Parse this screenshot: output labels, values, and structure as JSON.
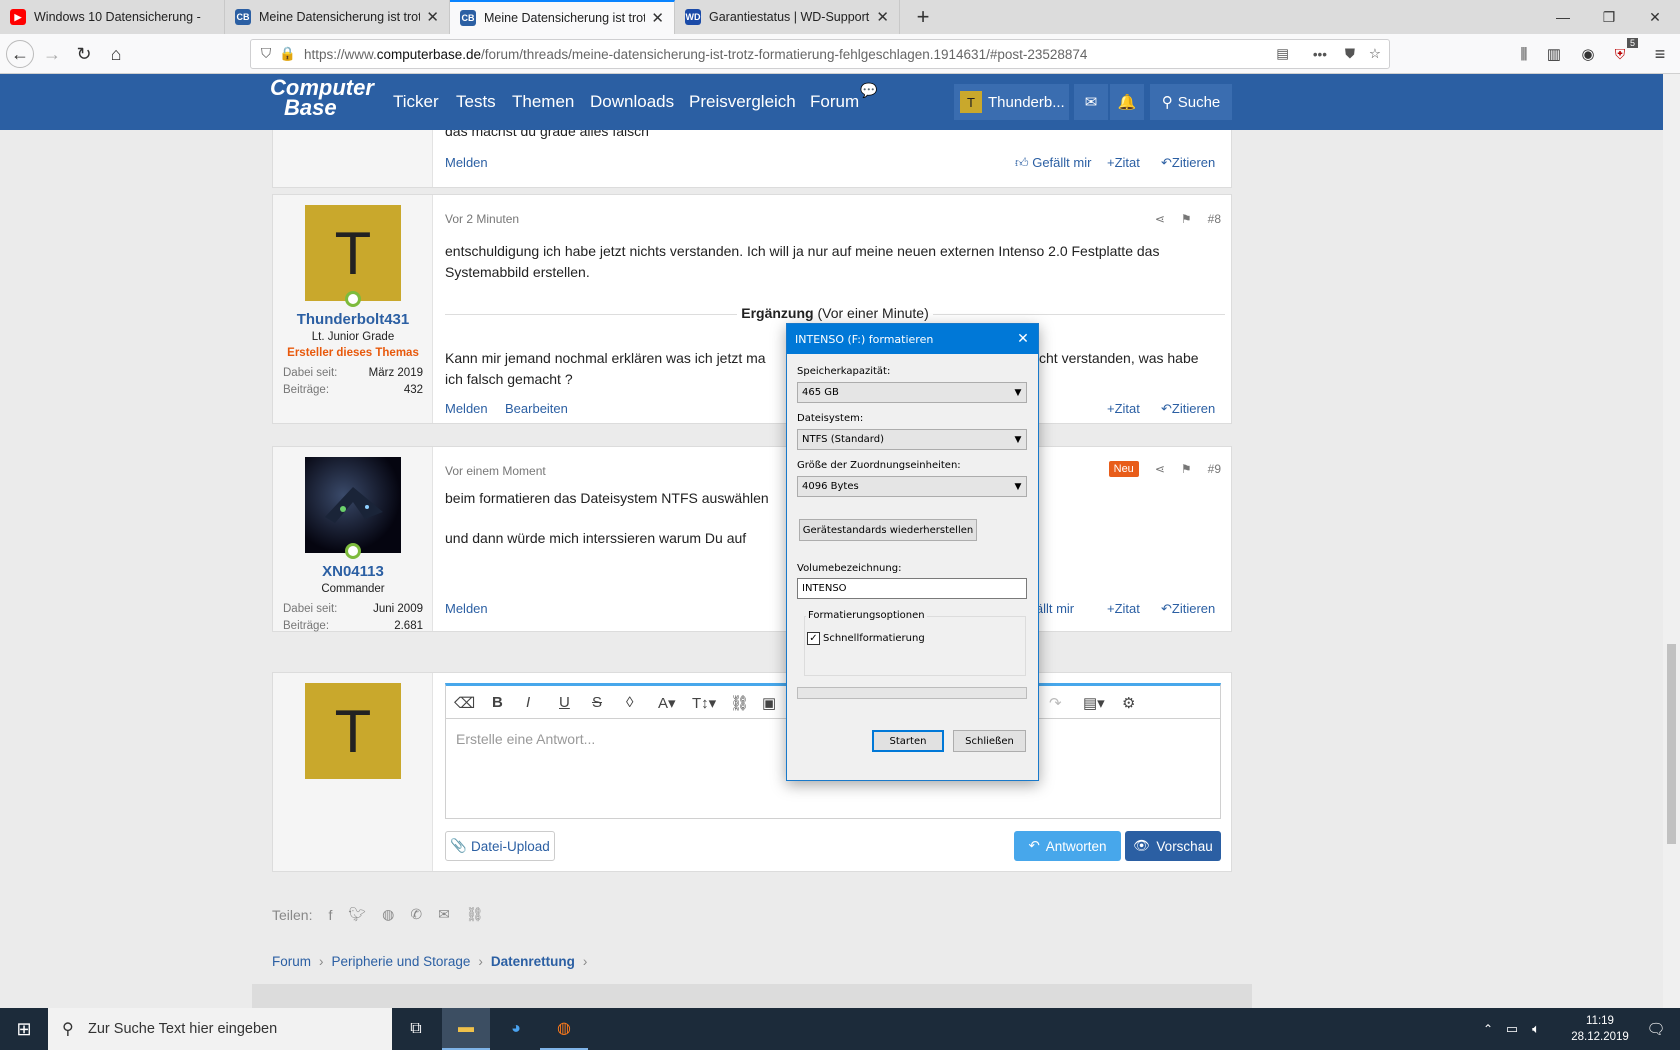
{
  "browser": {
    "tabs": [
      {
        "title": "Windows 10 Datensicherung - ",
        "favicon": "youtube",
        "color": "#ff0000"
      },
      {
        "title": "Meine Datensicherung ist trotz",
        "favicon": "computerbase",
        "color": "#2b5fa3"
      },
      {
        "title": "Meine Datensicherung ist trotz",
        "favicon": "computerbase",
        "color": "#2b5fa3",
        "active": true
      },
      {
        "title": "Garantiestatus | WD-Support",
        "favicon": "wd",
        "color": "#1a4aa8"
      }
    ],
    "url_prefix": "https://www.",
    "url_domain": "computerbase.de",
    "url_path": "/forum/threads/meine-datensicherung-ist-trotz-formatierung-fehlgeschlagen.1914631/#post-23528874",
    "badge": "5"
  },
  "site": {
    "logo_line1": "Computer",
    "logo_line2": "Base",
    "nav": [
      "Ticker",
      "Tests",
      "Themen",
      "Downloads",
      "Preisvergleich",
      "Forum"
    ],
    "user_short": "Thunderb...",
    "user_initial": "T",
    "search_label": "Suche"
  },
  "prev_post": {
    "partial_text": "das machst du grade alles falsch",
    "report": "Melden",
    "like": "Gefällt mir",
    "zitat": "+Zitat",
    "quote": "Zitieren"
  },
  "post8": {
    "avatar_letter": "T",
    "avatar_color": "#c9a82c",
    "username": "Thunderbolt431",
    "rank": "Lt. Junior Grade",
    "op_label": "Ersteller dieses Themas",
    "joined_label": "Dabei seit:",
    "joined": "März 2019",
    "posts_label": "Beiträge:",
    "posts": "432",
    "time": "Vor 2 Minuten",
    "number": "#8",
    "text": "entschuldigung ich habe jetzt nichts verstanden. Ich will ja nur auf meine neuen externen Intenso 2.0 Festplatte das Systemabbild erstellen.",
    "addendum_label": "Ergänzung",
    "addendum_time": "(Vor einer Minute)",
    "text2_left": "Kann mir jemand nochmal erklären was ich jetzt ma",
    "text2_right": "cht verstanden, was habe",
    "text2_line2": "ich falsch gemacht ?",
    "report": "Melden",
    "edit": "Bearbeiten",
    "zitat": "+Zitat",
    "quote": "Zitieren"
  },
  "post9": {
    "username": "XN04113",
    "rank": "Commander",
    "joined_label": "Dabei seit:",
    "joined": "Juni 2009",
    "posts_label": "Beiträge:",
    "posts": "2.681",
    "time": "Vor einem Moment",
    "new_badge": "Neu",
    "number": "#9",
    "line1": "beim formatieren das Dateisystem NTFS auswählen",
    "line2": "und dann würde mich interssieren warum Du auf",
    "report": "Melden",
    "like_partial": "efällt mir",
    "zitat": "+Zitat",
    "quote": "Zitieren"
  },
  "reply": {
    "avatar_letter": "T",
    "placeholder": "Erstelle eine Antwort...",
    "upload": "Datei-Upload",
    "submit": "Antworten",
    "preview": "Vorschau"
  },
  "share": {
    "label": "Teilen:"
  },
  "breadcrumb": [
    "Forum",
    "Peripherie und Storage",
    "Datenrettung"
  ],
  "dialog": {
    "title": "INTENSO (F:) formatieren",
    "capacity_label": "Speicherkapazität:",
    "capacity": "465 GB",
    "fs_label": "Dateisystem:",
    "fs": "NTFS (Standard)",
    "alloc_label": "Größe der Zuordnungseinheiten:",
    "alloc": "4096 Bytes",
    "restore_btn": "Gerätestandards wiederherstellen",
    "volume_label": "Volumebezeichnung:",
    "volume": "INTENSO",
    "options_label": "Formatierungsoptionen",
    "quick_label": "Schnellformatierung",
    "quick_checked": true,
    "progress": 0,
    "start": "Starten",
    "close": "Schließen"
  },
  "taskbar": {
    "search_placeholder": "Zur Suche Text hier eingeben",
    "time": "11:19",
    "date": "28.12.2019"
  }
}
